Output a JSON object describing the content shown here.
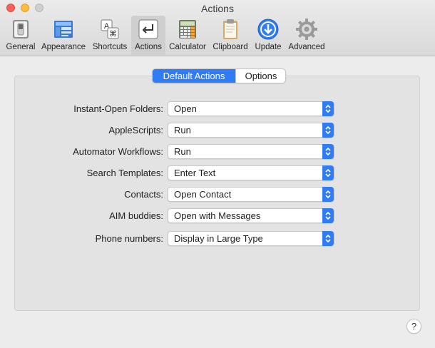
{
  "window": {
    "title": "Actions"
  },
  "toolbar": {
    "items": [
      {
        "label": "General",
        "icon": "general-switch-icon"
      },
      {
        "label": "Appearance",
        "icon": "appearance-icon"
      },
      {
        "label": "Shortcuts",
        "icon": "shortcuts-icon"
      },
      {
        "label": "Actions",
        "icon": "actions-return-icon",
        "selected": true
      },
      {
        "label": "Calculator",
        "icon": "calculator-icon"
      },
      {
        "label": "Clipboard",
        "icon": "clipboard-icon"
      },
      {
        "label": "Update",
        "icon": "update-download-icon"
      },
      {
        "label": "Advanced",
        "icon": "gear-icon"
      }
    ]
  },
  "tabs": {
    "default_actions": "Default Actions",
    "options": "Options",
    "active": "Default Actions"
  },
  "settings": [
    {
      "label": "Instant-Open Folders:",
      "value": "Open"
    },
    {
      "label": "AppleScripts:",
      "value": "Run"
    },
    {
      "label": "Automator Workflows:",
      "value": "Run"
    },
    {
      "label": "Search Templates:",
      "value": "Enter Text"
    },
    {
      "label": "Contacts:",
      "value": "Open Contact"
    },
    {
      "label": "AIM buddies:",
      "value": "Open with Messages"
    },
    {
      "label": "Phone numbers:",
      "value": "Display in Large Type"
    }
  ],
  "help": {
    "label": "?"
  },
  "colors": {
    "accent": "#2f7cf6",
    "panel": "#e3e3e3",
    "window": "#ececec"
  }
}
